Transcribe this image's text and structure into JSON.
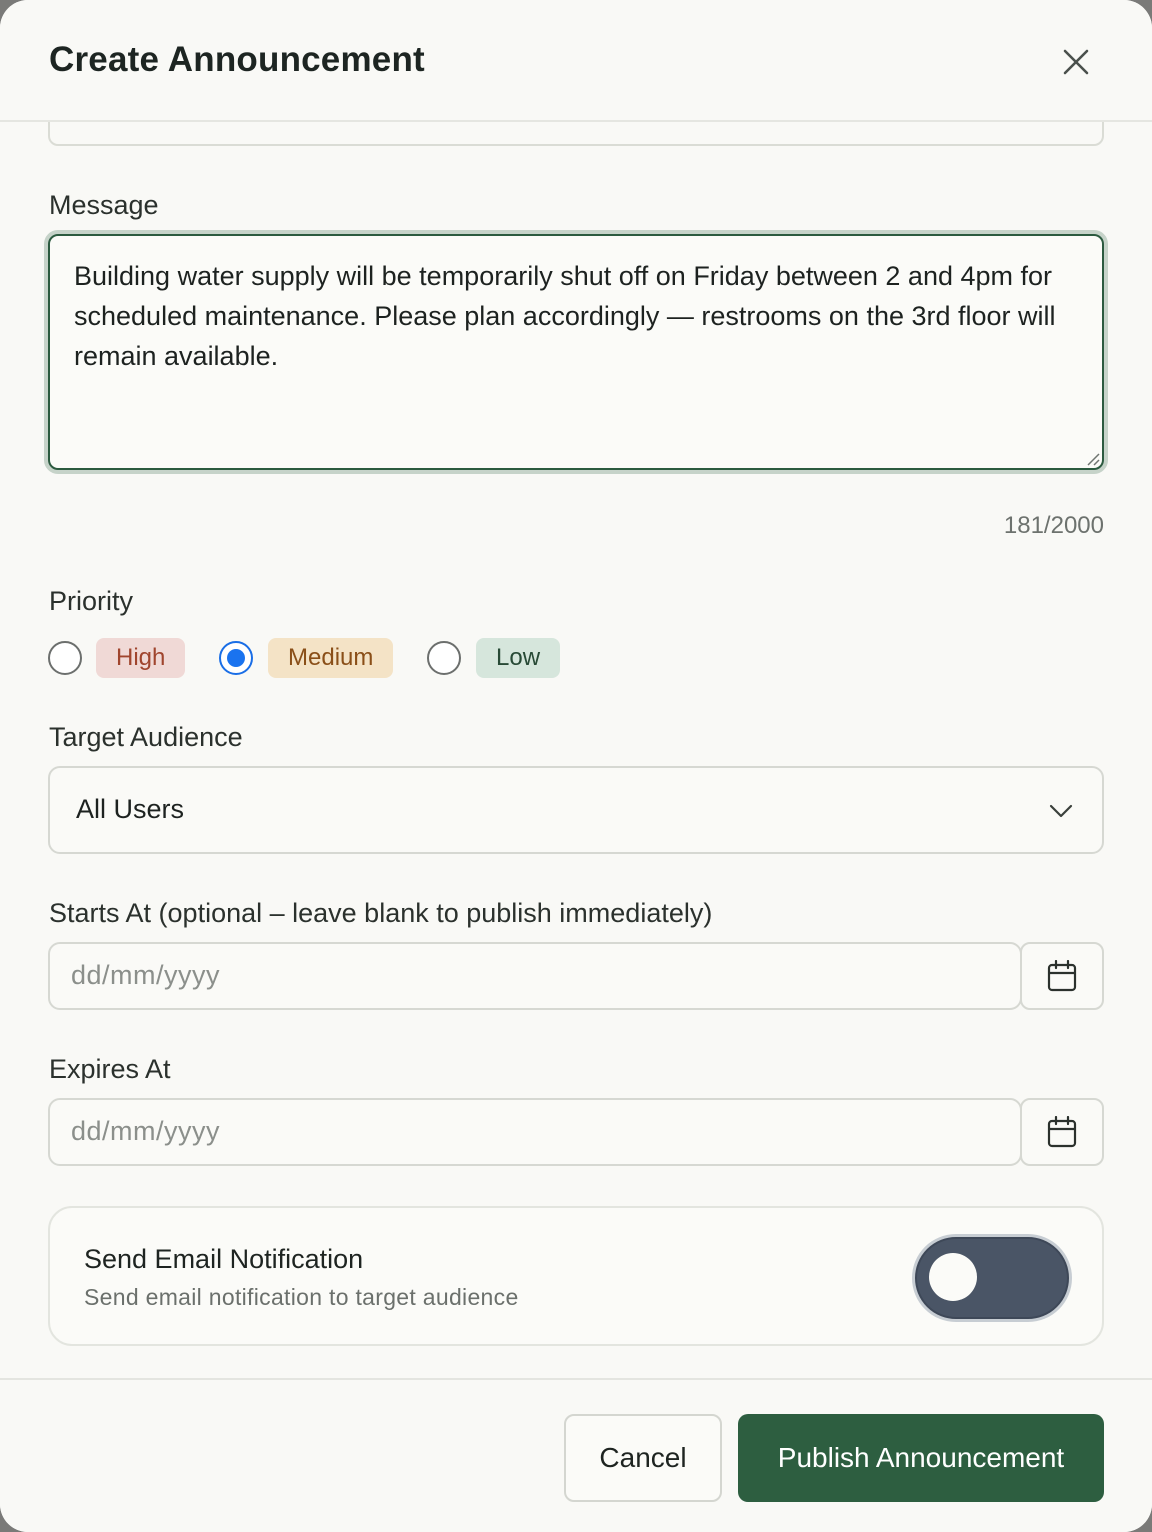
{
  "dialog": {
    "title": "Create Announcement",
    "close_icon": "close-icon"
  },
  "message": {
    "label": "Message",
    "value": "Building water supply will be temporarily shut off on Friday between 2 and 4pm for scheduled maintenance. Please plan accordingly — restrooms on the 3rd floor will remain available.",
    "counter": "181/2000"
  },
  "priority": {
    "label": "Priority",
    "options": [
      {
        "label": "High",
        "selected": false,
        "color": "#f0d9d6"
      },
      {
        "label": "Medium",
        "selected": true,
        "color": "#f4e3c6"
      },
      {
        "label": "Low",
        "selected": false,
        "color": "#d6e6dc"
      }
    ]
  },
  "audience": {
    "label": "Target Audience",
    "value": "All Users",
    "icon": "chevron-down-icon"
  },
  "starts_at": {
    "label": "Starts At (optional – leave blank to publish immediately)",
    "placeholder": "dd/mm/yyyy",
    "icon": "calendar-icon"
  },
  "expires_at": {
    "label": "Expires At",
    "placeholder": "dd/mm/yyyy",
    "icon": "calendar-icon"
  },
  "email_notification": {
    "title": "Send Email Notification",
    "subtitle": "Send email notification to target audience",
    "enabled": false
  },
  "footer": {
    "cancel_label": "Cancel",
    "publish_label": "Publish Announcement",
    "publish_color": "#2d5e40"
  }
}
